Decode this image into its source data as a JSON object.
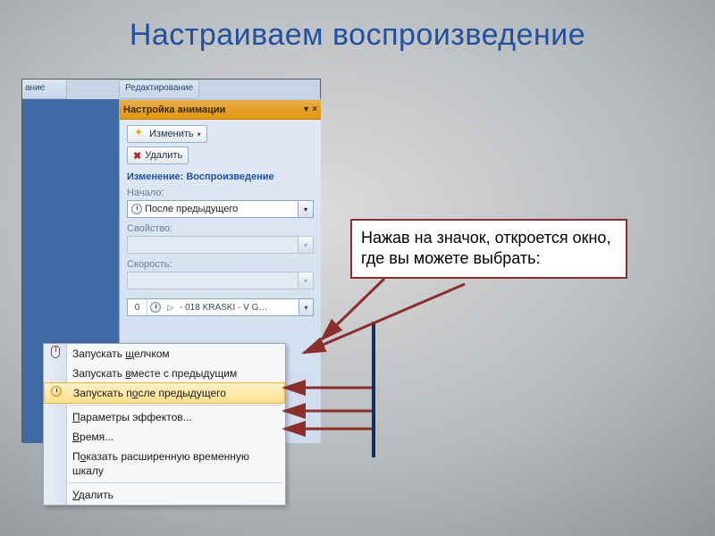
{
  "slide": {
    "title": "Настраиваем воспроизведение"
  },
  "ribbon": {
    "frag1": "ание",
    "frag2": "Редактирование"
  },
  "pane": {
    "title": "Настройка анимации",
    "close_caret": "▾",
    "close_x": "×",
    "btn_change": "Изменить",
    "btn_remove": "Удалить",
    "section": "Изменение: Воспроизведение",
    "label_start": "Начало:",
    "start_value": "После предыдущего",
    "label_property": "Свойство:",
    "label_speed": "Скорость:",
    "item_num": "0",
    "item_label": "- 018 KRASKI - V G…"
  },
  "menu": {
    "items": [
      "Запускать щелчком",
      "Запускать вместе с предыдущим",
      "Запускать после предыдущего",
      "Параметры эффектов...",
      "Время...",
      "Показать расширенную временную шкалу",
      "Удалить"
    ],
    "ul": {
      "i0": "щ",
      "i1": "в",
      "i2": "о",
      "i3": "П",
      "i4": "В",
      "i5": "о",
      "i6": "У"
    }
  },
  "callout": {
    "text": "Нажав на значок, откроется окно, где вы можете выбрать:"
  }
}
